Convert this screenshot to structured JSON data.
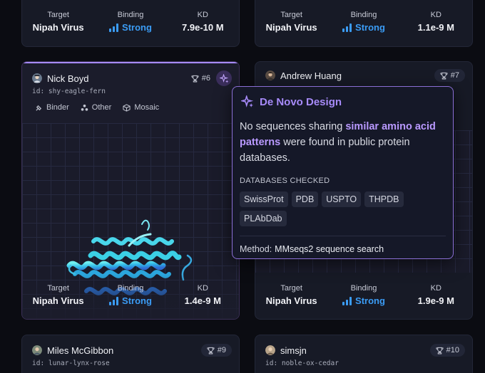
{
  "stat_labels": {
    "target": "Target",
    "binding": "Binding",
    "kd": "KD"
  },
  "cards": [
    {
      "target": "Nipah Virus",
      "binding": "Strong",
      "kd": "7.9e-10 M"
    },
    {
      "target": "Nipah Virus",
      "binding": "Strong",
      "kd": "1.1e-9 M"
    },
    {
      "user": "Nick Boyd",
      "rank": "#6",
      "id": "id: shy-eagle-fern",
      "tags": [
        "Binder",
        "Other",
        "Mosaic"
      ],
      "target": "Nipah Virus",
      "binding": "Strong",
      "kd": "1.4e-9 M"
    },
    {
      "user": "Andrew Huang",
      "rank": "#7",
      "target": "Nipah Virus",
      "binding": "Strong",
      "kd": "1.9e-9 M"
    },
    {
      "user": "Miles McGibbon",
      "rank": "#9",
      "id": "id: lunar-lynx-rose"
    },
    {
      "user": "simsjn",
      "rank": "#10",
      "id": "id: noble-ox-cedar"
    }
  ],
  "popover": {
    "title": "De Novo Design",
    "body_1": "No sequences sharing ",
    "body_highlight": "similar amino acid patterns",
    "body_2": " were found in public protein databases.",
    "section_label": "DATABASES CHECKED",
    "databases": [
      "SwissProt",
      "PDB",
      "USPTO",
      "THPDB",
      "PLAbDab"
    ],
    "method_label": "Method:",
    "method_value": "MMseqs2 sequence search"
  },
  "colors": {
    "accent": "#a78bfa",
    "binding": "#3b9cf5",
    "helix_light": "#5fe3f0",
    "helix_dark": "#2f6fd6"
  },
  "binding_strength": 3,
  "icons": {
    "rank": "trophy-icon",
    "spark": "sparkle-icon",
    "tag_binder": "binder-icon",
    "tag_other": "other-icon",
    "tag_mosaic": "mosaic-icon"
  }
}
